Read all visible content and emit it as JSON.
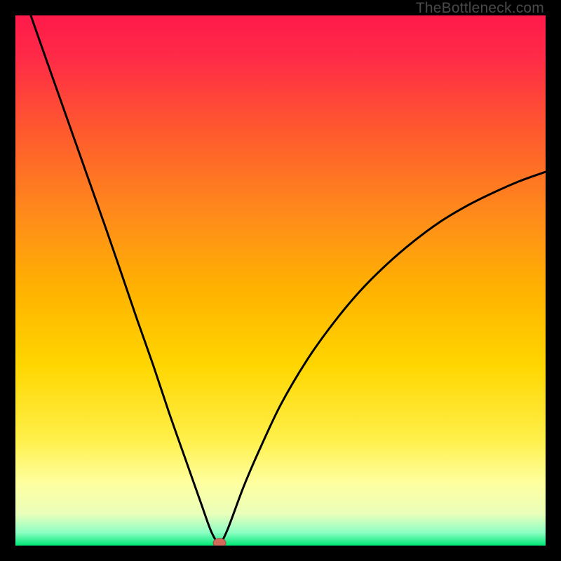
{
  "watermark": "TheBottleneck.com",
  "chart_data": {
    "type": "line",
    "title": "",
    "xlabel": "",
    "ylabel": "",
    "xlim": [
      0,
      100
    ],
    "ylim": [
      0,
      100
    ],
    "background_gradient": {
      "top": "#ff1744",
      "upper_mid": "#ff6d00",
      "mid": "#ffd600",
      "lower_mid": "#ffff8d",
      "bottom": "#00e676"
    },
    "series": [
      {
        "name": "bottleneck-curve",
        "x": [
          2.9,
          5,
          8,
          11,
          14,
          17,
          20,
          23,
          26,
          29,
          32,
          35,
          37,
          38.5,
          40,
          43,
          46,
          50,
          55,
          60,
          65,
          70,
          75,
          80,
          85,
          90,
          95,
          100
        ],
        "y": [
          100,
          94,
          85.5,
          77,
          68.5,
          60,
          51.3,
          42.5,
          34,
          25,
          16.5,
          8,
          2.5,
          0.5,
          3,
          11,
          18,
          26.5,
          35,
          42,
          48,
          53,
          57.3,
          61,
          64,
          66.5,
          68.7,
          70.5
        ]
      }
    ],
    "marker": {
      "name": "optimal-point",
      "x": 38.5,
      "y": 0.5,
      "color": "#d46a5a"
    }
  }
}
